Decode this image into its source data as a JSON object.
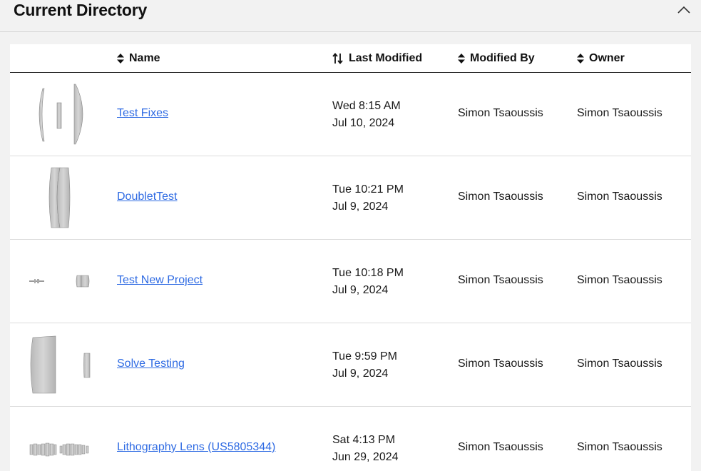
{
  "header": {
    "title": "Current Directory",
    "collapse_icon": "chevron-up-icon"
  },
  "table": {
    "columns": [
      {
        "key": "name",
        "label": "Name",
        "icon": "sort-icon"
      },
      {
        "key": "last_modified",
        "label": "Last Modified",
        "icon": "sort-ascending-icon"
      },
      {
        "key": "modified_by",
        "label": "Modified By",
        "icon": "sort-icon"
      },
      {
        "key": "owner",
        "label": "Owner",
        "icon": "sort-icon"
      }
    ],
    "rows": [
      {
        "name": "Test Fixes",
        "modified_line1": "Wed 8:15 AM",
        "modified_line2": "Jul 10, 2024",
        "modified_by": "Simon Tsaoussis",
        "owner": "Simon Tsaoussis",
        "thumbnail": "lens-system-thumbnail"
      },
      {
        "name": "DoubletTest",
        "modified_line1": "Tue 10:21 PM",
        "modified_line2": "Jul 9, 2024",
        "modified_by": "Simon Tsaoussis",
        "owner": "Simon Tsaoussis",
        "thumbnail": "lens-system-thumbnail"
      },
      {
        "name": "Test New Project",
        "modified_line1": "Tue 10:18 PM",
        "modified_line2": "Jul 9, 2024",
        "modified_by": "Simon Tsaoussis",
        "owner": "Simon Tsaoussis",
        "thumbnail": "lens-system-thumbnail"
      },
      {
        "name": "Solve Testing",
        "modified_line1": "Tue 9:59 PM",
        "modified_line2": "Jul 9, 2024",
        "modified_by": "Simon Tsaoussis",
        "owner": "Simon Tsaoussis",
        "thumbnail": "lens-system-thumbnail"
      },
      {
        "name": "Lithography Lens (US5805344)",
        "modified_line1": "Sat 4:13 PM",
        "modified_line2": "Jun 29, 2024",
        "modified_by": "Simon Tsaoussis",
        "owner": "Simon Tsaoussis",
        "thumbnail": "lens-system-thumbnail"
      }
    ]
  },
  "colors": {
    "link": "#2f6be3",
    "background": "#f2f2f2",
    "panel": "#ffffff",
    "lens_gray": "#c4c4c4"
  }
}
